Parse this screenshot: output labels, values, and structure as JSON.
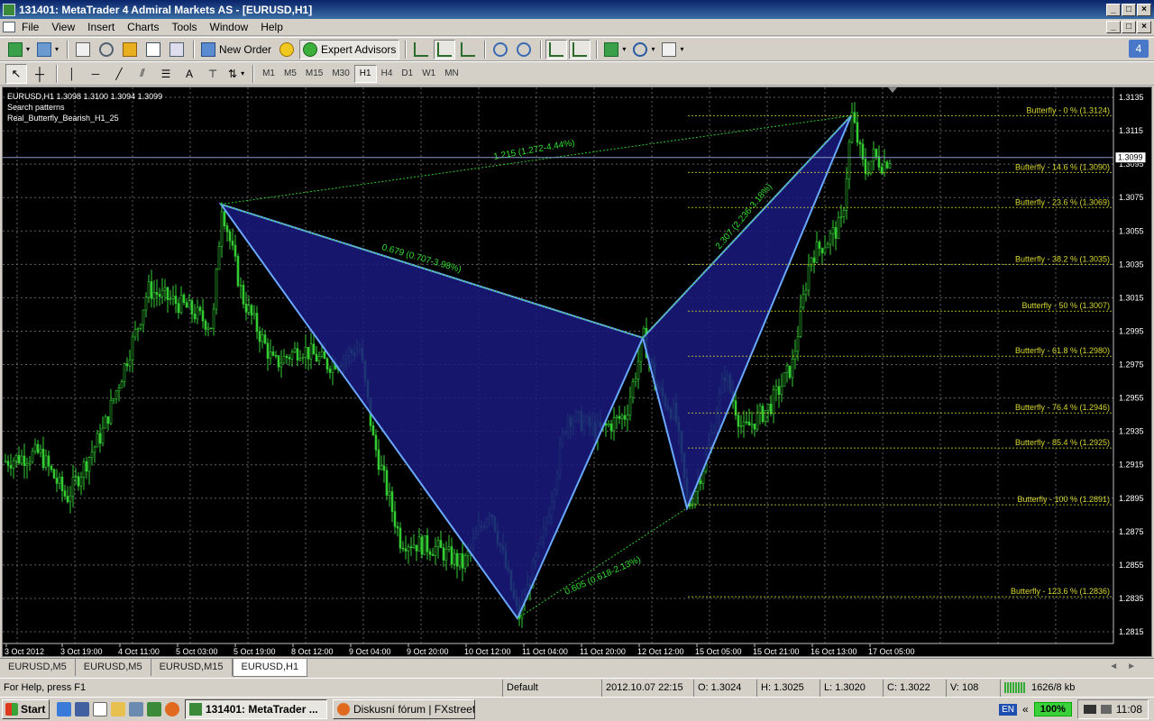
{
  "window": {
    "title": "131401: MetaTrader 4 Admiral Markets AS - [EURUSD,H1]"
  },
  "menu": [
    "File",
    "View",
    "Insert",
    "Charts",
    "Tools",
    "Window",
    "Help"
  ],
  "toolbar1": {
    "new_order": "New Order",
    "expert_advisors": "Expert Advisors"
  },
  "timeframes": [
    "M1",
    "M5",
    "M15",
    "M30",
    "H1",
    "H4",
    "D1",
    "W1",
    "MN"
  ],
  "active_timeframe": "H1",
  "help_badge": "4",
  "chart": {
    "info_line1": "EURUSD,H1  1.3098 1.3100 1.3094 1.3099",
    "info_line2": "Search patterns",
    "info_line3": "Real_Butterfly_Bearish_H1_25",
    "current_price": "1.3099",
    "x_labels": [
      "3 Oct 2012",
      "3 Oct 19:00",
      "4 Oct 11:00",
      "5 Oct 03:00",
      "5 Oct 19:00",
      "8 Oct 12:00",
      "9 Oct 04:00",
      "9 Oct 20:00",
      "10 Oct 12:00",
      "11 Oct 04:00",
      "11 Oct 20:00",
      "12 Oct 12:00",
      "15 Oct 05:00",
      "15 Oct 21:00",
      "16 Oct 13:00",
      "17 Oct 05:00"
    ],
    "y_labels": [
      "1.3135",
      "1.3115",
      "1.3095",
      "1.3075",
      "1.3055",
      "1.3035",
      "1.3015",
      "1.2995",
      "1.2975",
      "1.2955",
      "1.2935",
      "1.2915",
      "1.2895",
      "1.2875",
      "1.2855",
      "1.2835",
      "1.2815"
    ],
    "pattern_labels": {
      "xa_xd": "1.215 (1.272-4.44%)",
      "xb": "0.679 (0.707-3.98%)",
      "bd": "2.307 (2.236-3.18%)",
      "ac": "0.605 (0.618-2.13%)"
    },
    "fib_levels": [
      {
        "label": "Butterfly - 0 % (1.3124)",
        "price": 1.3124
      },
      {
        "label": "Butterfly - 14.6 % (1.3090)",
        "price": 1.309
      },
      {
        "label": "Butterfly - 23.6 % (1.3069)",
        "price": 1.3069
      },
      {
        "label": "Butterfly - 38.2 % (1.3035)",
        "price": 1.3035
      },
      {
        "label": "Butterfly - 50 % (1.3007)",
        "price": 1.3007
      },
      {
        "label": "Butterfly - 61.8 % (1.2980)",
        "price": 1.298
      },
      {
        "label": "Butterfly - 76.4 % (1.2946)",
        "price": 1.2946
      },
      {
        "label": "Butterfly - 85.4 % (1.2925)",
        "price": 1.2925
      },
      {
        "label": "Butterfly - 100 % (1.2891)",
        "price": 1.2891
      },
      {
        "label": "Butterfly - 123.6 % (1.2836)",
        "price": 1.2836
      }
    ],
    "pattern_points": {
      "X": 1.3071,
      "A": 1.2823,
      "B": 1.2991,
      "C": 1.2889,
      "D": 1.3124
    },
    "colors": {
      "background": "#000000",
      "candles": "#33cc33",
      "pattern_fill": "#1a1a80",
      "pattern_edge": "#6aa8ff",
      "fib": "#d8d830",
      "grid": "#8a8a8a"
    }
  },
  "chart_tabs": [
    "EURUSD,M5",
    "EURUSD,M5",
    "EURUSD,M15",
    "EURUSD,H1"
  ],
  "active_tab_index": 3,
  "status": {
    "help": "For Help, press F1",
    "profile": "Default",
    "datetime": "2012.10.07 22:15",
    "open": "O: 1.3024",
    "high": "H: 1.3025",
    "low": "L: 1.3020",
    "close": "C: 1.3022",
    "volume": "V: 108",
    "traffic": "1626/8 kb"
  },
  "taskbar": {
    "start": "Start",
    "task1": "131401: MetaTrader ...",
    "task2": "Diskusní fórum | FXstreet...",
    "lang": "EN",
    "zoom": "100%",
    "clock": "11:08"
  }
}
